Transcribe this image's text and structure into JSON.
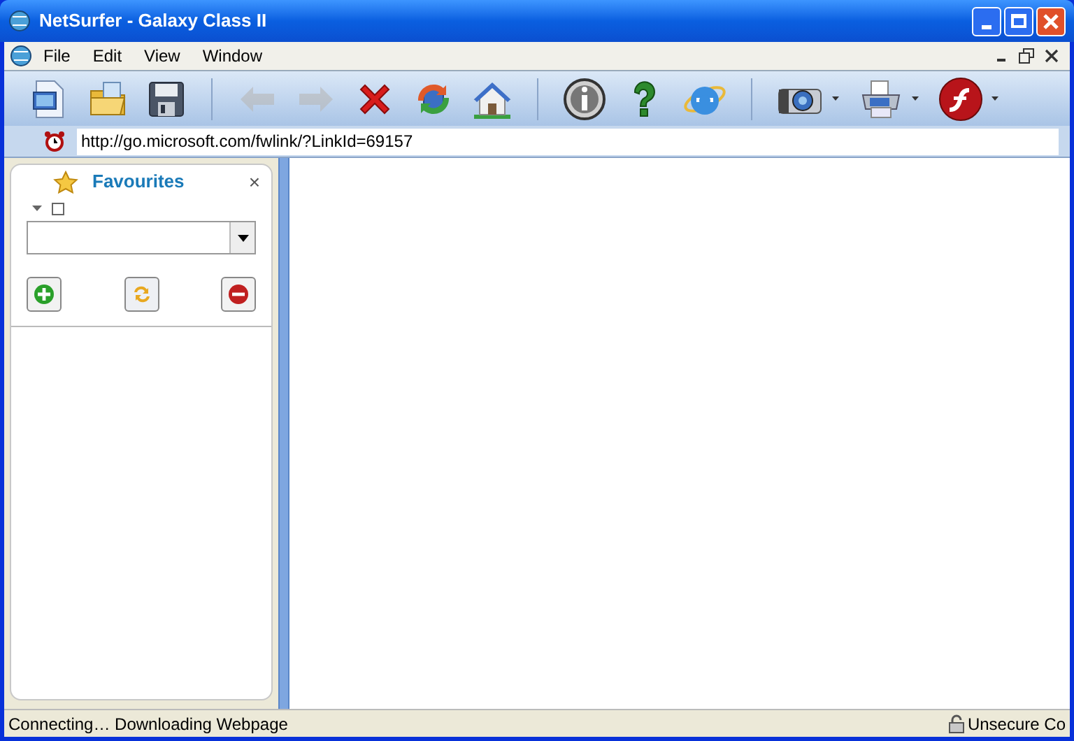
{
  "window": {
    "title": "NetSurfer - Galaxy Class II"
  },
  "menu": [
    {
      "label": "File"
    },
    {
      "label": "Edit"
    },
    {
      "label": "View"
    },
    {
      "label": "Window"
    }
  ],
  "toolbar": [
    {
      "kind": "new",
      "disabled": false,
      "dropdown": false
    },
    {
      "kind": "open",
      "disabled": false,
      "dropdown": false
    },
    {
      "kind": "save",
      "disabled": false,
      "dropdown": false
    },
    {
      "kind": "separator"
    },
    {
      "kind": "back",
      "disabled": true,
      "dropdown": false
    },
    {
      "kind": "forward",
      "disabled": true,
      "dropdown": false
    },
    {
      "kind": "stop",
      "disabled": false,
      "dropdown": false
    },
    {
      "kind": "refresh",
      "disabled": false,
      "dropdown": false
    },
    {
      "kind": "home",
      "disabled": false,
      "dropdown": false
    },
    {
      "kind": "separator"
    },
    {
      "kind": "info",
      "disabled": false,
      "dropdown": false
    },
    {
      "kind": "help",
      "disabled": false,
      "dropdown": false
    },
    {
      "kind": "browser",
      "disabled": false,
      "dropdown": false
    },
    {
      "kind": "separator"
    },
    {
      "kind": "camera",
      "disabled": false,
      "dropdown": true
    },
    {
      "kind": "printer",
      "disabled": false,
      "dropdown": true
    },
    {
      "kind": "flash",
      "disabled": false,
      "dropdown": true
    }
  ],
  "address": {
    "url": "http://go.microsoft.com/fwlink/?LinkId=69157"
  },
  "favourites": {
    "title": "Favourites",
    "close": "×"
  },
  "status_bar": {
    "message": "Connecting… Downloading Webpage",
    "security": "Unsecure Co"
  }
}
